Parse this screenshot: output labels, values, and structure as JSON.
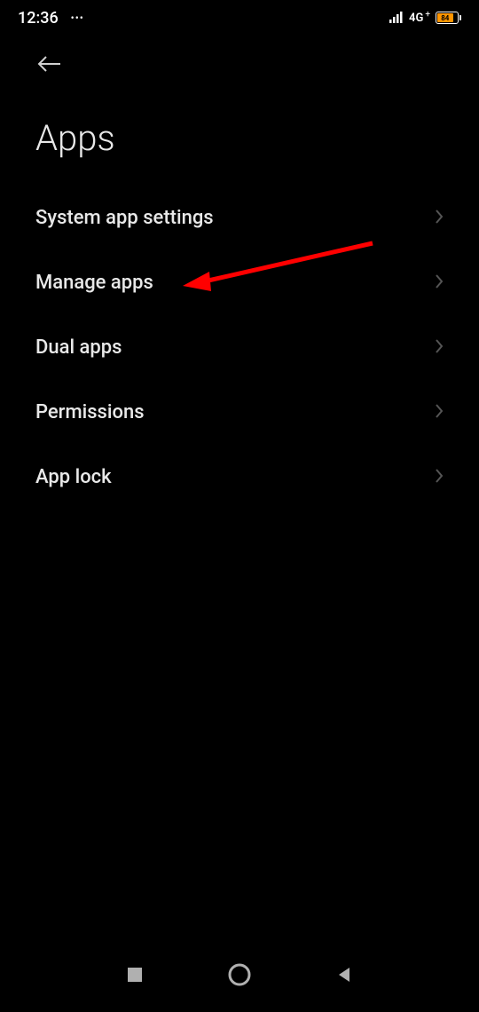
{
  "status_bar": {
    "time": "12:36",
    "network": "4G",
    "battery_text": "84"
  },
  "page": {
    "title": "Apps"
  },
  "settings": {
    "items": [
      {
        "label": "System app settings"
      },
      {
        "label": "Manage apps"
      },
      {
        "label": "Dual apps"
      },
      {
        "label": "Permissions"
      },
      {
        "label": "App lock"
      }
    ]
  }
}
